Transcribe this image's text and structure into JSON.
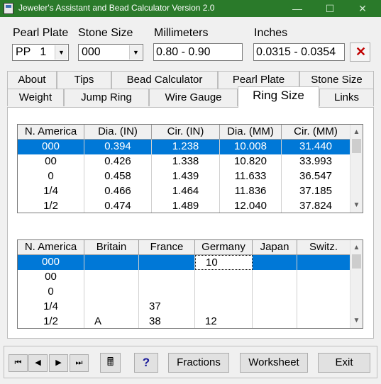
{
  "window": {
    "title": "Jeweler's Assistant and Bead Calculator Version 2.0",
    "minimize_glyph": "—",
    "maximize_glyph": "☐",
    "close_glyph": "✕"
  },
  "inputs": {
    "pearl_plate_label": "Pearl Plate",
    "pearl_plate_value": "PP   1",
    "stone_size_label": "Stone Size",
    "stone_size_value": "000",
    "millimeters_label": "Millimeters",
    "millimeters_value": "0.80 - 0.90",
    "inches_label": "Inches",
    "inches_value": "0.0315 - 0.0354",
    "clear_glyph": "✕",
    "dropdown_glyph": "▼"
  },
  "tabs": {
    "row1": [
      "About",
      "Tips",
      "Bead Calculator",
      "Pearl Plate",
      "Stone Size"
    ],
    "row2": [
      "Weight",
      "Jump Ring",
      "Wire Gauge",
      "Ring Size",
      "Links"
    ],
    "active": "Ring Size"
  },
  "table1": {
    "headers": [
      "N. America",
      "Dia. (IN)",
      "Cir. (IN)",
      "Dia. (MM)",
      "Cir. (MM)"
    ],
    "rows": [
      [
        "000",
        "0.394",
        "1.238",
        "10.008",
        "31.440"
      ],
      [
        "00",
        "0.426",
        "1.338",
        "10.820",
        "33.993"
      ],
      [
        "0",
        "0.458",
        "1.439",
        "11.633",
        "36.547"
      ],
      [
        "1/4",
        "0.466",
        "1.464",
        "11.836",
        "37.185"
      ],
      [
        "1/2",
        "0.474",
        "1.489",
        "12.040",
        "37.824"
      ]
    ],
    "selected_row": 0
  },
  "table2": {
    "headers": [
      "N. America",
      "Britain",
      "France",
      "Germany",
      "Japan",
      "Switz."
    ],
    "rows": [
      [
        "000",
        "",
        "",
        "10",
        "",
        ""
      ],
      [
        "00",
        "",
        "",
        "",
        "",
        ""
      ],
      [
        "0",
        "",
        "",
        "",
        "",
        ""
      ],
      [
        "1/4",
        "",
        "37",
        "",
        "",
        ""
      ],
      [
        "1/2",
        "A",
        "38",
        "12",
        "",
        ""
      ]
    ],
    "selected_row": 0
  },
  "scroll": {
    "up": "▲",
    "down": "▼"
  },
  "bottom": {
    "nav_first": "⏮",
    "nav_prev": "◀",
    "nav_next": "▶",
    "nav_last": "⏭",
    "calculator_glyph": "🖩",
    "help_label": "?",
    "fractions_label": "Fractions",
    "worksheet_label": "Worksheet",
    "exit_label": "Exit"
  }
}
